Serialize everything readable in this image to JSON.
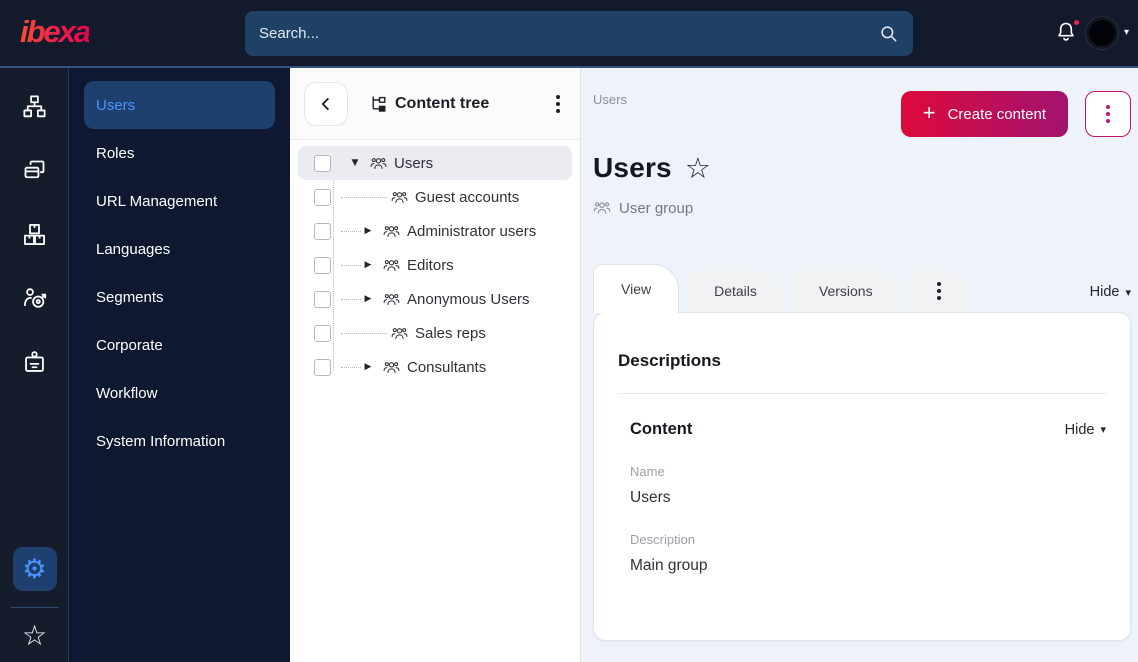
{
  "topbar": {
    "logo_text": "ibexa",
    "search": {
      "placeholder": "Search..."
    }
  },
  "icon_rail": {
    "items": [
      "content-structure",
      "pages",
      "products",
      "audience",
      "corporate-badge"
    ],
    "footer": [
      "settings",
      "bookmarks"
    ]
  },
  "sidebar": {
    "items": [
      {
        "label": "Users",
        "active": true
      },
      {
        "label": "Roles",
        "active": false
      },
      {
        "label": "URL Management",
        "active": false
      },
      {
        "label": "Languages",
        "active": false
      },
      {
        "label": "Segments",
        "active": false
      },
      {
        "label": "Corporate",
        "active": false
      },
      {
        "label": "Workflow",
        "active": false
      },
      {
        "label": "System Information",
        "active": false
      }
    ]
  },
  "content_tree": {
    "title": "Content tree",
    "items": [
      {
        "label": "Users",
        "level": 0,
        "caret": "expanded",
        "selected": true
      },
      {
        "label": "Guest accounts",
        "level": 1,
        "caret": "none",
        "selected": false
      },
      {
        "label": "Administrator users",
        "level": 1,
        "caret": "collapsed",
        "selected": false
      },
      {
        "label": "Editors",
        "level": 1,
        "caret": "collapsed",
        "selected": false
      },
      {
        "label": "Anonymous Users",
        "level": 1,
        "caret": "collapsed",
        "selected": false
      },
      {
        "label": "Sales reps",
        "level": 1,
        "caret": "none",
        "selected": false
      },
      {
        "label": "Consultants",
        "level": 1,
        "caret": "collapsed",
        "selected": false
      }
    ]
  },
  "main": {
    "breadcrumb": "Users",
    "actions": {
      "create_label": "Create content"
    },
    "title": "Users",
    "content_type_label": "User group",
    "tabs": [
      {
        "label": "View",
        "active": true
      },
      {
        "label": "Details",
        "active": false
      },
      {
        "label": "Versions",
        "active": false
      }
    ],
    "tabs_hide_label": "Hide",
    "panel": {
      "heading": "Descriptions",
      "section": {
        "heading": "Content",
        "hide_label": "Hide",
        "fields": [
          {
            "label": "Name",
            "value": "Users"
          },
          {
            "label": "Description",
            "value": "Main group"
          }
        ]
      }
    }
  },
  "icons": {
    "gear": "⚙",
    "star": "☆",
    "plus": "+",
    "caret_down": "▼",
    "caret_right": "▶",
    "hide_caret": "▾",
    "profile_caret": "▾"
  },
  "colors": {
    "topbar_bg": "#131a2c",
    "sidebar_bg": "#0e1830",
    "accent_blue": "#4b93ff",
    "selected_item_bg": "#1d406f",
    "brand_gradient_start": "#dd0a3b",
    "brand_gradient_end": "#a21370",
    "notification_dot": "#e8254a",
    "main_bg": "#eef2f9"
  }
}
